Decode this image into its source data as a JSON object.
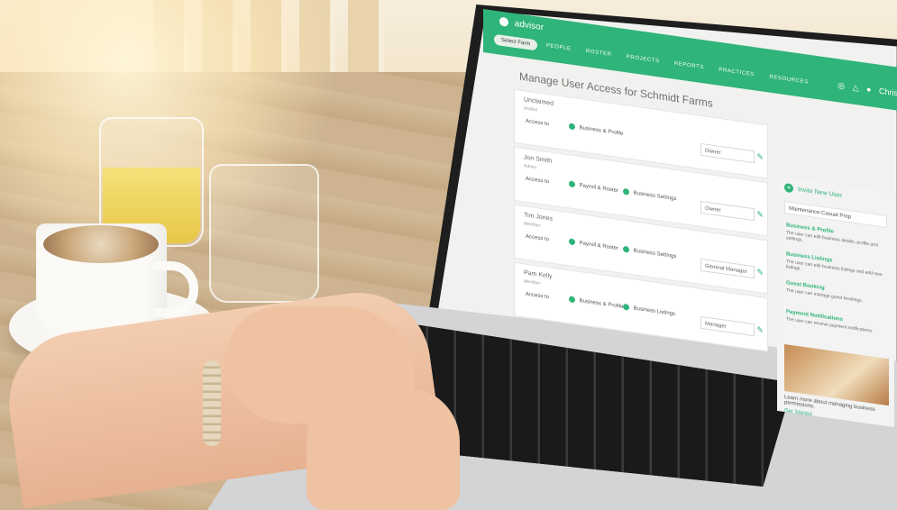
{
  "ui": {
    "brand": "advisor",
    "selector": "Select Farm",
    "nav": [
      "PEOPLE",
      "ROSTER",
      "PROJECTS",
      "REPORTS",
      "PRACTICES",
      "RESOURCES"
    ],
    "icons": [
      "gift-icon",
      "bell-icon",
      "user-icon"
    ],
    "user": "Chris",
    "page_title": "Manage User Access for Schmidt Farms",
    "cards": [
      {
        "name": "Unclaimed",
        "small": "Invited",
        "label": "Access to",
        "chips": [
          "Business & Profile"
        ],
        "role": "Owner"
      },
      {
        "name": "Jon Smith",
        "small": "Admin",
        "label": "Access to",
        "chips": [
          "Payroll & Roster",
          "Business Settings"
        ],
        "role": "Owner"
      },
      {
        "name": "Tim Jones",
        "small": "Member",
        "label": "Access to",
        "chips": [
          "Payroll & Roster",
          "Business Settings"
        ],
        "role": "General Manager"
      },
      {
        "name": "Pam Kelly",
        "small": "Member",
        "label": "Access to",
        "chips": [
          "Business & Profile",
          "Business Listings"
        ],
        "role": "Manager"
      }
    ],
    "sidebar": {
      "invite": "Invite New User",
      "role": "Maintenance Casual Prep",
      "permissions": [
        {
          "title": "Business & Profile",
          "desc": "The user can edit business details, profile and settings."
        },
        {
          "title": "Business Listings",
          "desc": "The user can edit business listings and add new listings."
        },
        {
          "title": "Guest Booking",
          "desc": "The user can manage guest bookings."
        },
        {
          "title": "Payment Notifications",
          "desc": "The user can receive payment notifications."
        }
      ],
      "learn": "Learn more about managing business permissions.",
      "learn_link": "Get Started"
    }
  }
}
